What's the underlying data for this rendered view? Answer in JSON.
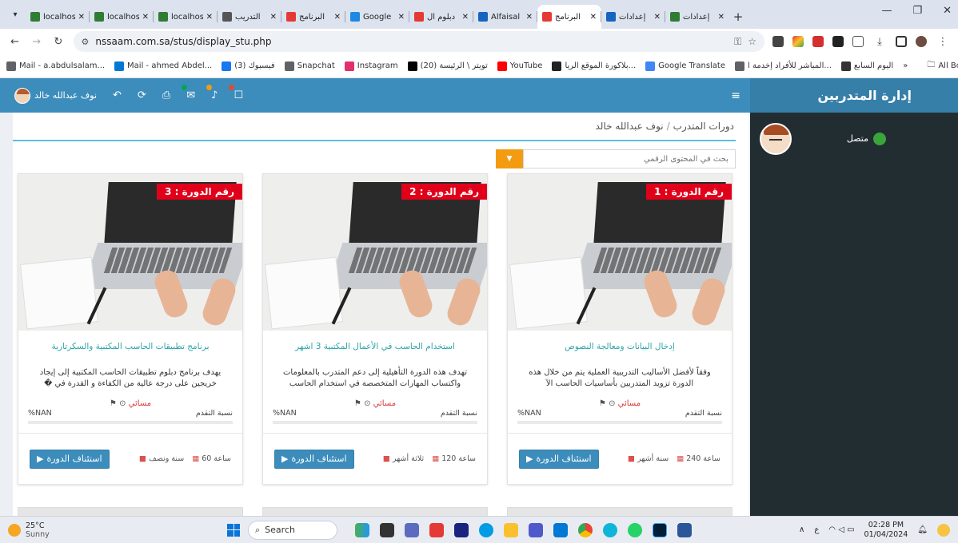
{
  "browser": {
    "tabs": [
      {
        "title": "localhos",
        "color": "#2e7d32",
        "active": false
      },
      {
        "title": "localhos",
        "color": "#2e7d32",
        "active": false
      },
      {
        "title": "localhos",
        "color": "#2e7d32",
        "active": false
      },
      {
        "title": "التدريب",
        "color": "#555555",
        "active": false
      },
      {
        "title": "البرنامج",
        "color": "#e53935",
        "active": false
      },
      {
        "title": "Google",
        "color": "#1e88e5",
        "active": false
      },
      {
        "title": "دبلوم ال",
        "color": "#e53935",
        "active": false
      },
      {
        "title": "Alfaisal",
        "color": "#1565c0",
        "active": false
      },
      {
        "title": "البرنامج",
        "color": "#e53935",
        "active": true
      },
      {
        "title": "إعدادات",
        "color": "#1565c0",
        "active": false
      },
      {
        "title": "إعدادات",
        "color": "#2e7d32",
        "active": false
      }
    ],
    "url": "nssaam.com.sa/stus/display_stu.php",
    "bookmarks": [
      "Mail - a.abdulsalam...",
      "Mail - ahmed Abdel...",
      "(3) فيسبوك",
      "Snapchat",
      "Instagram",
      "(20) تويتر \\ الرئيسة",
      "YouTube",
      "بلاكورة الموقع الريا...",
      "Google Translate",
      "المباشر للأفراد إخدمة ا...",
      "اليوم السابع"
    ],
    "all_bookmarks": "All Bookmarks",
    "overflow": "»"
  },
  "app": {
    "sidebar_title": "إدارة المتدربين",
    "status_label": "متصل",
    "topbar_user": "نوف عبدالله خالد",
    "breadcrumb": {
      "root": "دورات المتدرب",
      "current": "نوف عبدالله خالد"
    },
    "search_placeholder": "بحث في المحتوى الرقمي"
  },
  "courses": [
    {
      "number_label": "رقم الدورة : 1",
      "title": "إدخال البيانات ومعالجة النصوص",
      "description": "وفقاً لأفضل الأساليب التدريبية العملية يتم من خلال هذه الدورة تزويد المتدربين بأساسيات الحاسب الآ",
      "schedule": "مسائي",
      "progress_label": "نسبة التقدم",
      "progress_value": "%NAN",
      "hours": "240 ساعة",
      "duration": "سنة أشهر",
      "button": "استئناف الدورة"
    },
    {
      "number_label": "رقم الدورة : 2",
      "title": "استخدام الحاسب في الأعمال المكتبية 3 اشهر",
      "description": "تهدف هذه الدورة التأهيلية إلى دعم المتدرب بالمعلومات واكتساب المهارات المتخصصة في استخدام الحاسب",
      "schedule": "مسائي",
      "progress_label": "نسبة التقدم",
      "progress_value": "%NAN",
      "hours": "120 ساعة",
      "duration": "ثلاثة أشهر",
      "button": "استئناف الدورة"
    },
    {
      "number_label": "رقم الدورة : 3",
      "title": "برنامج تطبيقات الحاسب المكتبية والسكرتارية",
      "description": "يهدف برنامج دبلوم تطبيقات الحاسب المكتبية إلى إيجاد خريجين على درجة عالية من الكفاءة و القدرة في �",
      "schedule": "مسائي",
      "progress_label": "نسبة التقدم",
      "progress_value": "%NAN",
      "hours": "60 ساعة",
      "duration": "سنة ونصف",
      "button": "استئناف الدورة"
    }
  ],
  "taskbar": {
    "temperature": "25°C",
    "weather": "Sunny",
    "search": "Search",
    "time": "02:28 PM",
    "date": "01/04/2024",
    "lang": "ع"
  }
}
